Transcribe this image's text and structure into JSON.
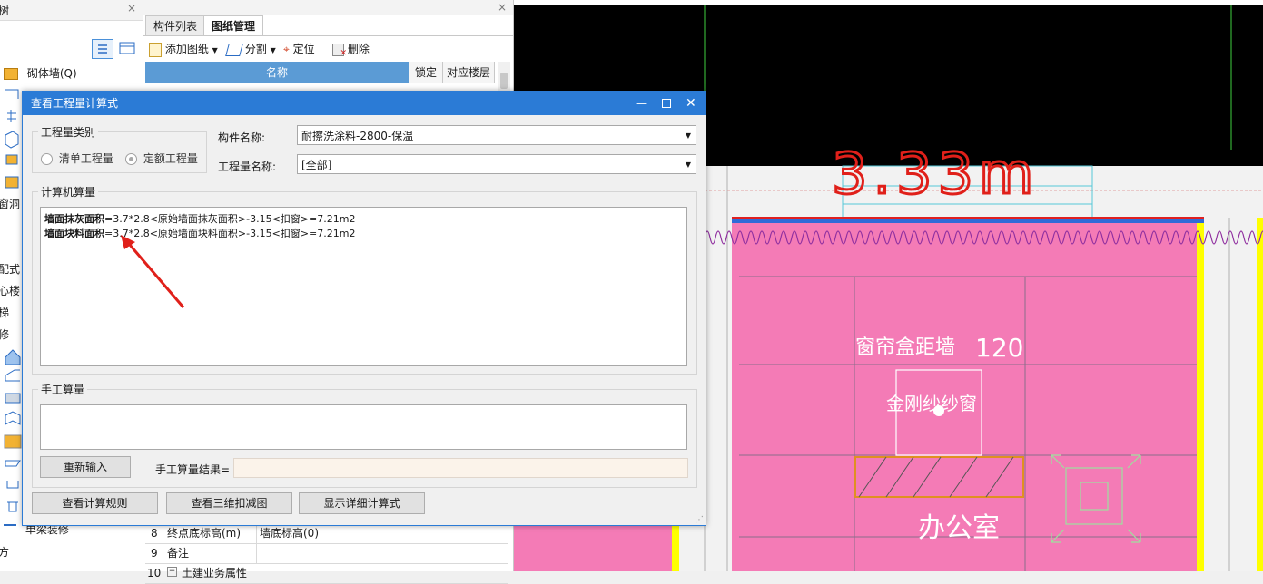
{
  "left_panel": {
    "title_partial": "树",
    "items": [
      {
        "label": "砌体墙(Q)",
        "icon": "brick-wall-icon"
      },
      {
        "label": "窗洞",
        "icon": "window-icon"
      },
      {
        "label": "配式",
        "icon": ""
      },
      {
        "label": "心楼",
        "icon": ""
      },
      {
        "label": "梯",
        "icon": ""
      },
      {
        "label": "修",
        "icon": ""
      },
      {
        "label": "单梁装修",
        "icon": "beam-icon"
      },
      {
        "label": "方",
        "icon": ""
      }
    ]
  },
  "mid_panel": {
    "tabs": [
      "构件列表",
      "图纸管理"
    ],
    "toolbar": {
      "add": "添加图纸",
      "split": "分割",
      "locate": "定位",
      "delete": "删除"
    },
    "columns": [
      "名称",
      "锁定",
      "对应楼层"
    ],
    "props": [
      {
        "num": "8",
        "name": "终点底标高(m)",
        "value": "墙底标高(0)"
      },
      {
        "num": "9",
        "name": "备注",
        "value": ""
      },
      {
        "num": "10",
        "name": "土建业务属性",
        "value": ""
      }
    ]
  },
  "dialog": {
    "title": "查看工程量计算式",
    "qty_type": {
      "label": "工程量类别",
      "options": [
        "清单工程量",
        "定额工程量"
      ],
      "selected": "定额工程量"
    },
    "component_name": {
      "label": "构件名称:",
      "value": "耐擦洗涂料-2800-保温"
    },
    "qty_name": {
      "label": "工程量名称:",
      "value": "[全部]"
    },
    "computer_calc": {
      "label": "计算机算量",
      "lines": [
        {
          "name": "墙面抹灰面积",
          "formula": "=3.7*2.8<原始墙面抹灰面积>-3.15<扣窗>=7.21m2"
        },
        {
          "name": "墙面块料面积",
          "formula": "=3.7*2.8<原始墙面块料面积>-3.15<扣窗>=7.21m2"
        }
      ]
    },
    "manual_calc": {
      "label": "手工算量",
      "reinput": "重新输入",
      "result_label": "手工算量结果=",
      "result_value": ""
    },
    "buttons": [
      "查看计算规则",
      "查看三维扣减图",
      "显示详细计算式"
    ]
  },
  "cad": {
    "annotation": "3.33m",
    "labels": {
      "curtain": "窗帘盒距墙",
      "curtain_dim": "120",
      "window": "金刚纱纱窗",
      "room": "办公室"
    }
  },
  "colors": {
    "accent": "#2b7bd6",
    "room_fill": "#f47bb6",
    "wall_yellow": "#ffff00",
    "annotation_red": "#e0201a"
  }
}
